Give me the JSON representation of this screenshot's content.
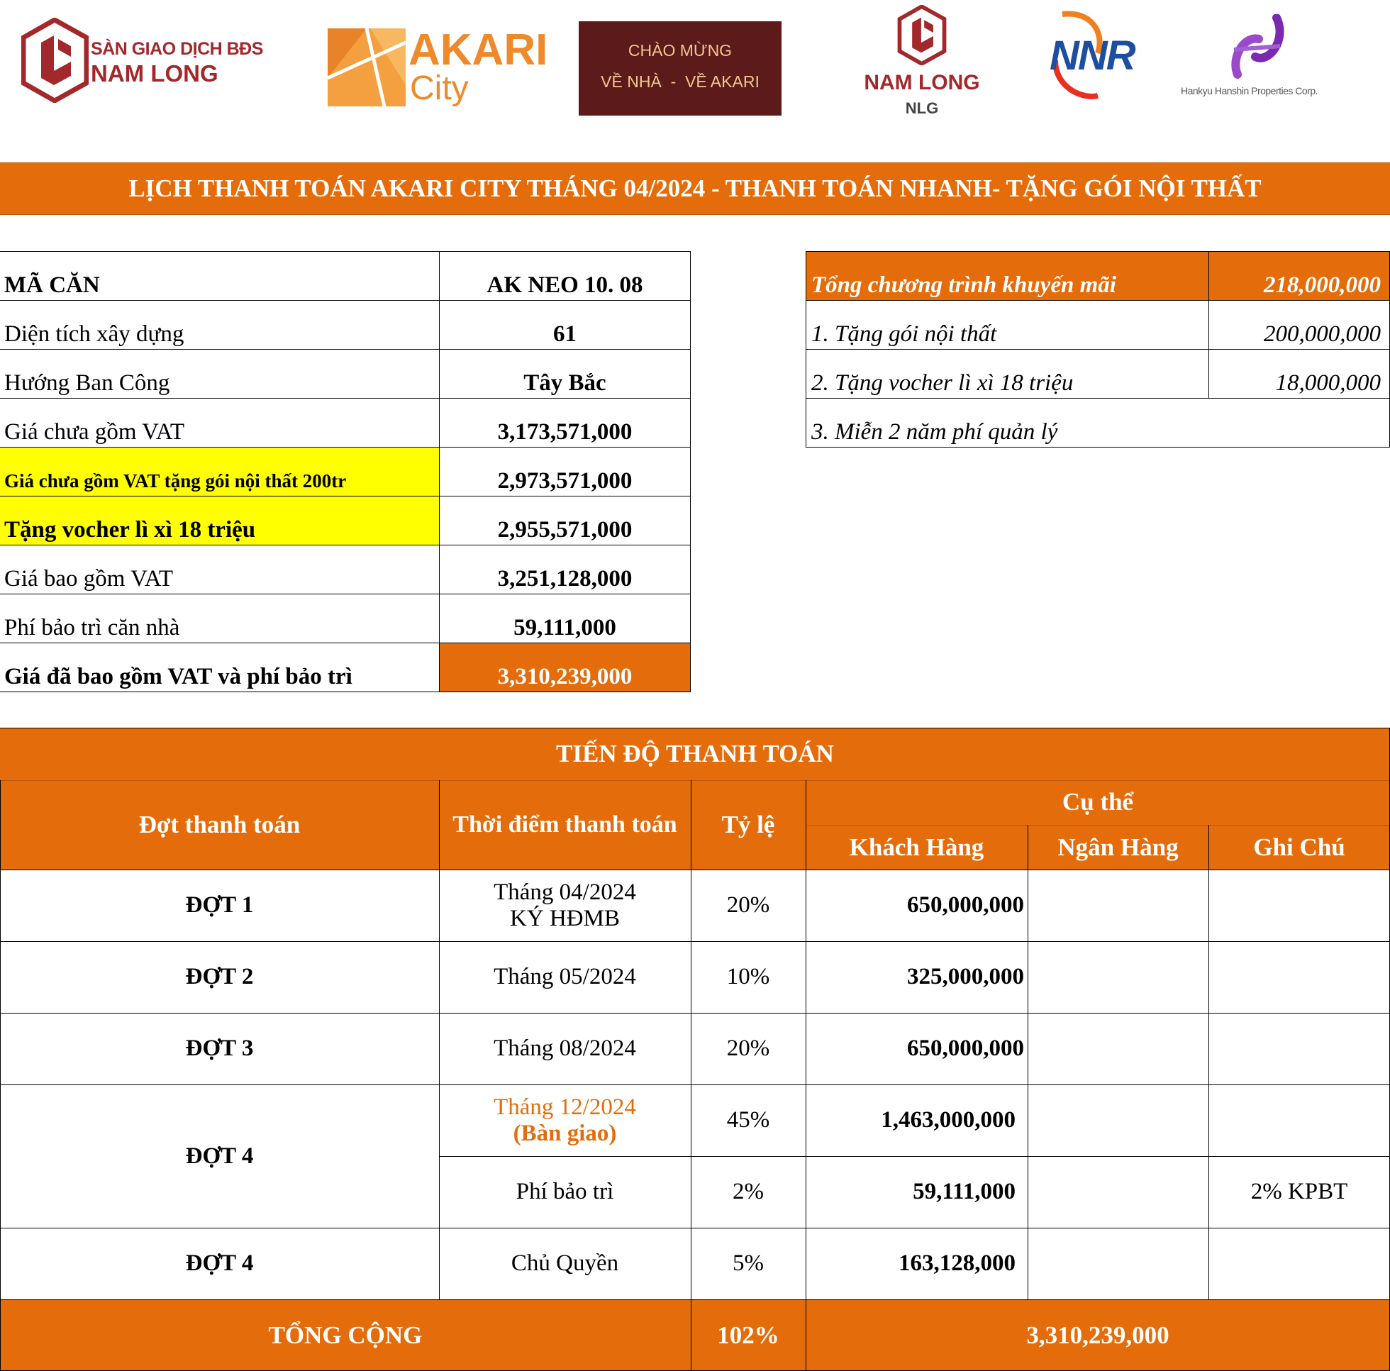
{
  "logos": {
    "nam_long_exchange": {
      "line1": "SÀN GIAO DỊCH BĐS",
      "line2": "NAM LONG"
    },
    "akari": {
      "line1": "AKARI",
      "line2": "City"
    },
    "welcome": {
      "line1": "CHÀO MỪNG",
      "line2": "VỀ NHÀ  -  VỀ AKARI"
    },
    "nam_long_nlg": {
      "line1": "NAM LONG",
      "line2": "NLG"
    },
    "nnr": {
      "text": "NNR"
    },
    "hankyu": {
      "text": "Hankyu Hanshin Properties Corp."
    }
  },
  "banner": {
    "title": "LỊCH THANH TOÁN AKARI CITY THÁNG 04/2024 - THANH TOÁN NHANH- TẶNG GÓI NỘI THẤT"
  },
  "unit_info": {
    "rows": [
      {
        "label": "MÃ CĂN",
        "value": "AK NEO 10. 08"
      },
      {
        "label": "Diện tích xây dựng",
        "value": "61"
      },
      {
        "label": "Hướng Ban Công",
        "value": "Tây Bắc"
      },
      {
        "label": "Giá chưa gồm VAT",
        "value": "3,173,571,000"
      },
      {
        "label": "Giá chưa gồm VAT  tặng gói nội thất 200tr",
        "value": "2,973,571,000"
      },
      {
        "label": "Tặng vocher lì xì 18 triệu",
        "value": "2,955,571,000"
      },
      {
        "label": "Giá bao gồm VAT",
        "value": "3,251,128,000"
      },
      {
        "label": "Phí bảo trì căn nhà",
        "value": "59,111,000"
      },
      {
        "label": "Giá đã bao gồm VAT và phí bảo trì",
        "value": "3,310,239,000"
      }
    ]
  },
  "promotion": {
    "header": {
      "label": "Tổng chương trình khuyến mãi",
      "value": "218,000,000"
    },
    "rows": [
      {
        "label": "1. Tặng gói nội thất",
        "value": "200,000,000"
      },
      {
        "label": "2. Tặng vocher lì xì 18 triệu",
        "value": "18,000,000"
      },
      {
        "label": "3. Miễn 2 năm phí quản lý",
        "value": ""
      }
    ]
  },
  "schedule": {
    "title": "TIẾN ĐỘ THANH TOÁN",
    "headers": {
      "installment": "Đợt thanh toán",
      "time": "Thời điểm thanh toán",
      "rate": "Tỷ lệ",
      "detail": "Cụ thể",
      "customer": "Khách Hàng",
      "bank": "Ngân Hàng",
      "note": "Ghi Chú"
    },
    "rows": [
      {
        "installment": "ĐỢT 1",
        "time_line1": "Tháng 04/2024",
        "time_line2": "KÝ HĐMB",
        "rate": "20%",
        "customer": "650,000,000",
        "bank": "",
        "note": ""
      },
      {
        "installment": "ĐỢT 2",
        "time_line1": "Tháng 05/2024",
        "time_line2": "",
        "rate": "10%",
        "customer": "325,000,000",
        "bank": "",
        "note": ""
      },
      {
        "installment": "ĐỢT 3",
        "time_line1": "Tháng 08/2024",
        "time_line2": "",
        "rate": "20%",
        "customer": "650,000,000",
        "bank": "",
        "note": ""
      },
      {
        "installment": "ĐỢT 4",
        "time_line1": "Tháng 12/2024",
        "time_line2": "(Bàn giao)",
        "rate": "45%",
        "customer": "1,463,000,000",
        "bank": "",
        "note": ""
      },
      {
        "installment": "",
        "time_line1": "Phí bảo trì",
        "time_line2": "",
        "rate": "2%",
        "customer": "59,111,000",
        "bank": "",
        "note": "2% KPBT"
      },
      {
        "installment": "ĐỢT 4",
        "time_line1": "Chủ Quyền",
        "time_line2": "",
        "rate": "5%",
        "customer": "163,128,000",
        "bank": "",
        "note": ""
      }
    ],
    "total": {
      "label": "TỔNG CỘNG",
      "rate": "102%",
      "amount": "3,310,239,000"
    }
  },
  "colors": {
    "orange": "#E46C0A",
    "highlight_yellow": "#FFFF00",
    "logo_red": "#A3282B",
    "maroon": "#5C1A1A"
  }
}
